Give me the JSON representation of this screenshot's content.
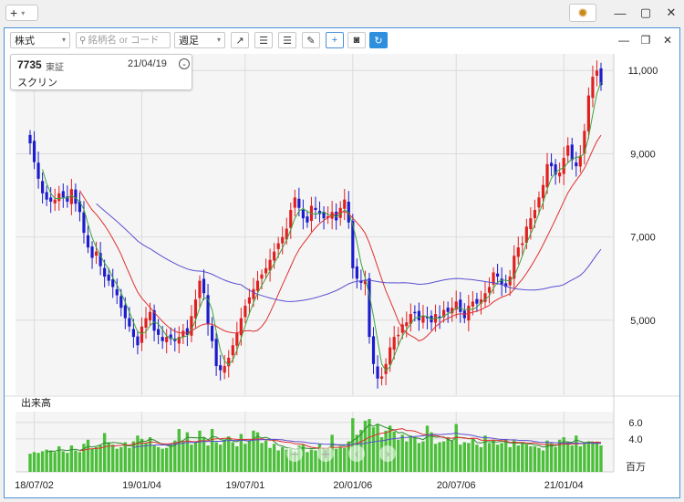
{
  "titlebar": {
    "add_label": "+",
    "gear_icon": "gear-icon",
    "minimize_label": "—",
    "maximize_label": "▢",
    "close_label": "✕"
  },
  "toolbar": {
    "type_select": "株式",
    "search_placeholder": "銘柄名 or コード",
    "period_select": "週足"
  },
  "info": {
    "code": "7735",
    "market": "東証",
    "date": "21/04/19",
    "name": "スクリン"
  },
  "volume_panel": {
    "title": "出来高",
    "unit": "百万"
  },
  "colors": {
    "up": "#e02020",
    "down": "#1c1ccc",
    "ma_short": "#3aa53a",
    "ma_mid": "#e03030",
    "ma_long": "#5a4fd0",
    "volume_bar": "#4cbf3a"
  },
  "chart_data": {
    "type": "candlestick",
    "price_axis": {
      "ticks": [
        5000,
        7000,
        9000,
        11000
      ],
      "tick_labels": [
        "5,000",
        "7,000",
        "9,000",
        "11,000"
      ],
      "range": [
        3200,
        11400
      ]
    },
    "volume_axis": {
      "ticks": [
        4.0,
        6.0
      ],
      "tick_labels": [
        "4.0",
        "6.0"
      ],
      "range": [
        0,
        7.3
      ],
      "unit": "百万"
    },
    "x_axis": {
      "tick_labels": [
        "18/07/02",
        "19/01/04",
        "19/07/01",
        "20/01/06",
        "20/07/06",
        "21/01/04"
      ],
      "tick_index": [
        1,
        27,
        52,
        78,
        103,
        129
      ]
    },
    "close": [
      9250,
      8800,
      8400,
      8050,
      7900,
      7850,
      7900,
      8050,
      7950,
      7850,
      8150,
      7800,
      7600,
      7100,
      6750,
      6500,
      6650,
      6300,
      6050,
      5950,
      5800,
      5600,
      5300,
      5050,
      4850,
      4600,
      4400,
      4850,
      5050,
      5200,
      4750,
      4650,
      4500,
      4600,
      4550,
      4500,
      4600,
      4750,
      4650,
      5100,
      5500,
      5950,
      5650,
      4900,
      4500,
      3900,
      3800,
      3900,
      4100,
      4400,
      4700,
      5050,
      5350,
      5550,
      5750,
      5950,
      6100,
      6250,
      6450,
      6650,
      6850,
      7000,
      7200,
      7650,
      7950,
      7700,
      7450,
      7350,
      7750,
      7650,
      7550,
      7450,
      7500,
      7600,
      7400,
      7700,
      7900,
      7350,
      6250,
      6000,
      5900,
      5950,
      4600,
      3950,
      3600,
      3650,
      3950,
      4350,
      4600,
      4650,
      4900,
      4950,
      5150,
      5200,
      5000,
      5100,
      5050,
      4950,
      5150,
      5050,
      5250,
      5200,
      5300,
      5450,
      5200,
      5050,
      5350,
      5450,
      5400,
      5500,
      5650,
      5800,
      6150,
      6050,
      5850,
      5800,
      6050,
      6550,
      6750,
      6850,
      7250,
      7450,
      7650,
      7950,
      8250,
      8750,
      8700,
      8500,
      8550,
      8900,
      9200,
      8850,
      8700,
      8950,
      9550,
      10400,
      10850,
      11000,
      10650
    ],
    "volume": [
      2.2,
      2.4,
      2.3,
      2.5,
      2.7,
      2.6,
      2.4,
      3.1,
      2.5,
      2.3,
      3.2,
      2.6,
      2.4,
      3.4,
      3.9,
      2.8,
      3.0,
      3.2,
      4.7,
      3.6,
      3.3,
      2.8,
      3.0,
      3.6,
      2.9,
      3.7,
      4.4,
      4.0,
      3.5,
      4.2,
      3.2,
      3.0,
      2.8,
      2.9,
      3.4,
      3.8,
      5.2,
      3.7,
      4.8,
      3.3,
      3.7,
      5.0,
      4.2,
      3.2,
      5.2,
      3.6,
      3.3,
      3.9,
      4.3,
      3.6,
      3.1,
      4.6,
      3.4,
      3.8,
      5.0,
      4.8,
      3.5,
      3.8,
      2.9,
      3.4,
      2.6,
      3.0,
      2.7,
      2.8,
      2.5,
      3.2,
      3.3,
      2.4,
      2.7,
      2.6,
      3.4,
      2.9,
      2.8,
      4.5,
      2.8,
      3.0,
      2.9,
      3.7,
      6.5,
      4.5,
      5.1,
      6.2,
      6.4,
      5.4,
      5.8,
      4.2,
      5.0,
      5.6,
      4.9,
      3.9,
      4.5,
      3.7,
      4.4,
      4.2,
      3.5,
      3.7,
      5.6,
      4.8,
      3.4,
      3.6,
      3.7,
      4.2,
      3.8,
      5.8,
      3.3,
      3.6,
      3.5,
      4.1,
      3.3,
      3.0,
      4.4,
      3.5,
      3.9,
      3.3,
      3.5,
      3.9,
      3.0,
      3.8,
      3.2,
      3.6,
      3.3,
      3.1,
      3.1,
      2.9,
      2.6,
      3.8,
      3.5,
      3.0,
      3.9,
      4.2,
      3.6,
      3.2,
      4.4,
      3.1,
      3.5,
      3.7,
      3.5,
      3.6,
      3.2
    ]
  }
}
